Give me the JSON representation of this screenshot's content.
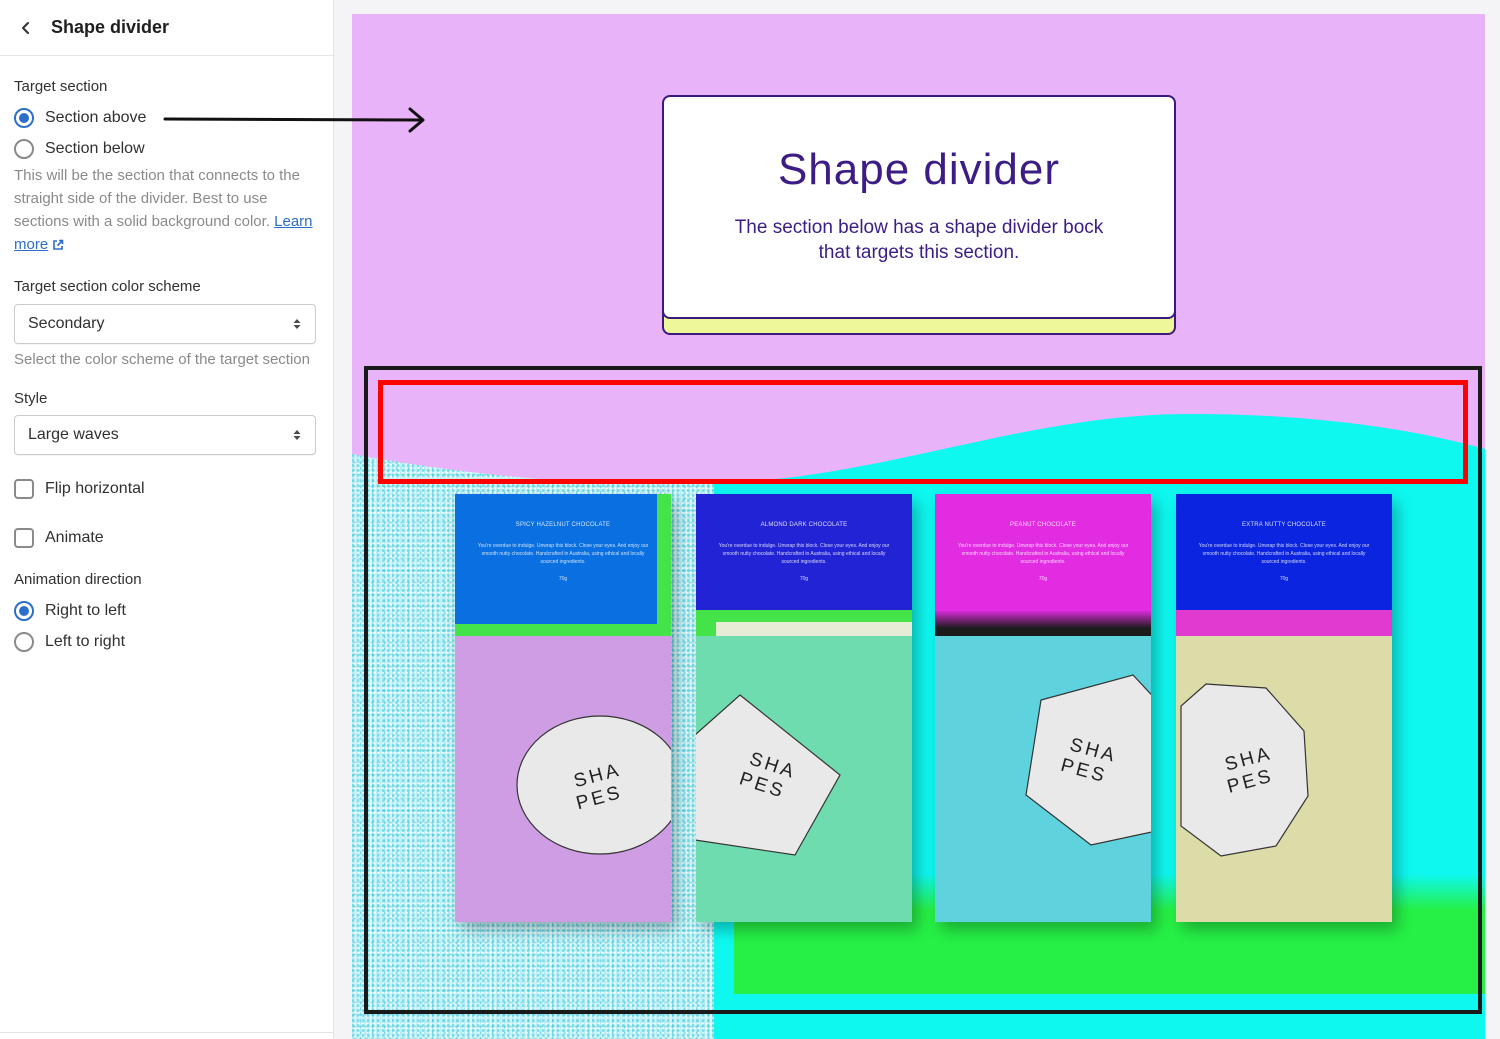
{
  "sidebar": {
    "title": "Shape divider",
    "target_section": {
      "label": "Target section",
      "options": [
        {
          "label": "Section above",
          "checked": true
        },
        {
          "label": "Section below",
          "checked": false
        }
      ],
      "help": "This will be the section that connects to the straight side of the divider. Best to use sections with a solid background color.",
      "learn_more": "Learn more"
    },
    "color_scheme": {
      "label": "Target section color scheme",
      "value": "Secondary",
      "help": "Select the color scheme of the target section"
    },
    "style": {
      "label": "Style",
      "value": "Large waves"
    },
    "flip_horizontal": {
      "label": "Flip horizontal",
      "checked": false
    },
    "animate": {
      "label": "Animate",
      "checked": false
    },
    "animation_direction": {
      "label": "Animation direction",
      "options": [
        {
          "label": "Right to left",
          "checked": true
        },
        {
          "label": "Left to right",
          "checked": false
        }
      ]
    }
  },
  "preview": {
    "hero": {
      "title": "Shape divider",
      "subtitle": "The section below has a shape divider bock that targets this section."
    },
    "products": [
      {
        "name": "SPICY HAZELNUT CHOCOLATE",
        "desc": "You're overdue to indulge. Unwrap this block. Close your eyes. And enjoy our smooth nutty chocolate. Handcrafted in Australia, using ethical and locally sourced ingredients.",
        "weight": "70g",
        "label_text": "SHA PES",
        "colors": {
          "top": "#0a6fe0",
          "stripe": "#45e34a",
          "body": "#cf9de3"
        }
      },
      {
        "name": "ALMOND DARK CHOCOLATE",
        "desc": "You're overdue to indulge. Unwrap this block. Close your eyes. And enjoy our smooth nutty chocolate. Handcrafted in Australia, using ethical and locally sourced ingredients.",
        "weight": "70g",
        "label_text": "SHA PES",
        "colors": {
          "top": "#2323d6",
          "stripe": "#45e34a",
          "body": "#6fdcb0"
        }
      },
      {
        "name": "PEANUT CHOCOLATE",
        "desc": "You're overdue to indulge. Unwrap this block. Close your eyes. And enjoy our smooth nutty chocolate. Handcrafted in Australia, using ethical and locally sourced ingredients.",
        "weight": "70g",
        "label_text": "SHA PES",
        "colors": {
          "top": "#e22ce2",
          "stripe": "#1b1b1b",
          "body": "#5fd3dd"
        }
      },
      {
        "name": "EXTRA NUTTY CHOCOLATE",
        "desc": "You're overdue to indulge. Unwrap this block. Close your eyes. And enjoy our smooth nutty chocolate. Handcrafted in Australia, using ethical and locally sourced ingredients.",
        "weight": "70g",
        "label_text": "SHA PES",
        "colors": {
          "top": "#0b24e0",
          "stripe": "#e03ad0",
          "body": "#dcdca8"
        }
      }
    ],
    "colors": {
      "section_above": "#e8b3f8",
      "section_below": "#0ef8f0",
      "accent_text": "#3b1d85",
      "highlight_red": "#ff0000"
    }
  }
}
